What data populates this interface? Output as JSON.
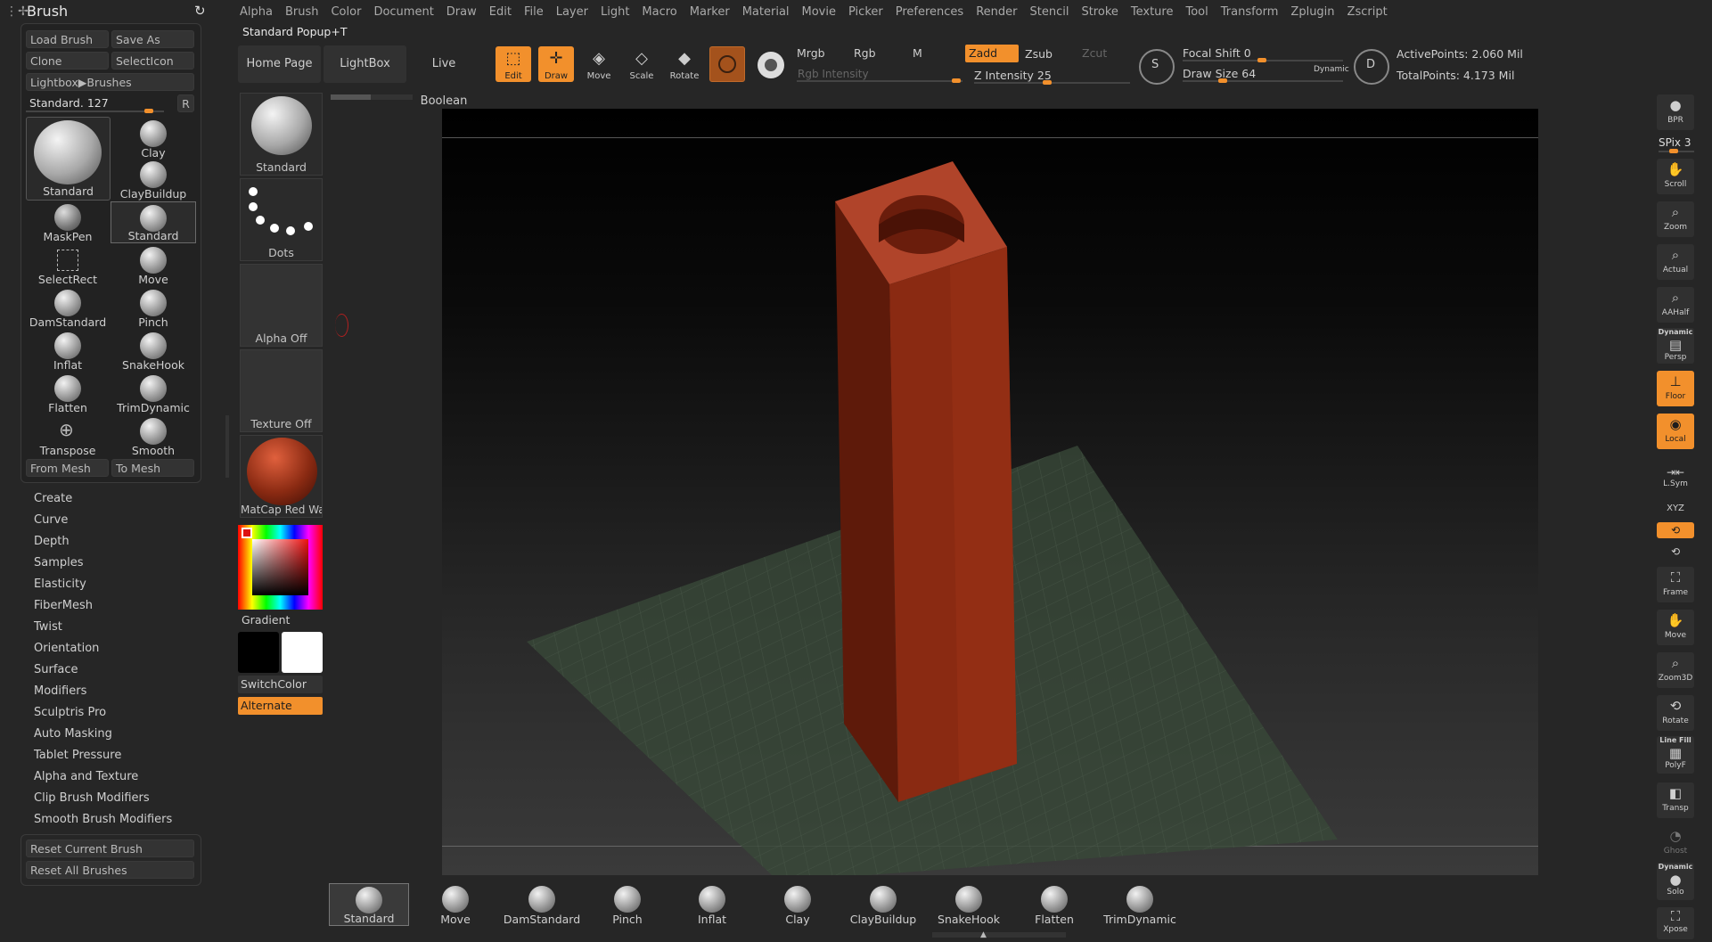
{
  "menu": [
    "Alpha",
    "Brush",
    "Color",
    "Document",
    "Draw",
    "Edit",
    "File",
    "Layer",
    "Light",
    "Macro",
    "Marker",
    "Material",
    "Movie",
    "Picker",
    "Preferences",
    "Render",
    "Stencil",
    "Stroke",
    "Texture",
    "Tool",
    "Transform",
    "Zplugin",
    "Zscript"
  ],
  "brush_panel": {
    "title": "Brush",
    "load": "Load Brush",
    "save_as": "Save As",
    "clone": "Clone",
    "select_icon": "SelectIcon",
    "lightbox_brushes": "Lightbox▶Brushes",
    "slider_label": "Standard. 127",
    "r": "R",
    "current": "Standard",
    "brushes": [
      "Clay",
      "ClayBuildup",
      "MaskPen",
      "Standard",
      "SelectRect",
      "Move",
      "DamStandard",
      "Pinch",
      "Inflat",
      "SnakeHook",
      "Flatten",
      "TrimDynamic",
      "Transpose",
      "Smooth"
    ],
    "from_mesh": "From Mesh",
    "to_mesh": "To Mesh",
    "subpalettes": [
      "Create",
      "Curve",
      "Depth",
      "Samples",
      "Elasticity",
      "FiberMesh",
      "Twist",
      "Orientation",
      "Surface",
      "Modifiers",
      "Sculptris Pro",
      "Auto Masking",
      "Tablet Pressure",
      "Alpha and Texture",
      "Clip Brush Modifiers",
      "Smooth Brush Modifiers"
    ],
    "reset_current": "Reset Current Brush",
    "reset_all": "Reset All Brushes"
  },
  "popup_title": "Standard Popup+T",
  "tool_column": {
    "brush": "Standard",
    "stroke": "Dots",
    "alpha": "Alpha Off",
    "texture": "Texture Off",
    "material": "MatCap Red Wax",
    "gradient": "Gradient",
    "switch_color": "SwitchColor",
    "alternate": "Alternate"
  },
  "top": {
    "home": "Home Page",
    "lightbox": "LightBox",
    "live_boolean": "Live Boolean",
    "edit": "Edit",
    "draw": "Draw",
    "move": "Move",
    "scale": "Scale",
    "rotate": "Rotate",
    "mrgb": "Mrgb",
    "rgb": "Rgb",
    "m": "M",
    "zadd": "Zadd",
    "zsub": "Zsub",
    "zcut": "Zcut",
    "rgb_intensity": "Rgb Intensity",
    "z_intensity": "Z Intensity 25",
    "focal_shift": "Focal Shift 0",
    "draw_size": "Draw Size 64",
    "dynamic": "Dynamic",
    "active_points": "ActivePoints: 2.060 Mil",
    "total_points": "TotalPoints: 4.173 Mil",
    "z_intensity_value": 25,
    "draw_size_value": 64,
    "brush_slider_value": 127
  },
  "right_shelf": {
    "bpr": "BPR",
    "spix": "SPix 3",
    "scroll": "Scroll",
    "zoom": "Zoom",
    "actual": "Actual",
    "aahalf": "AAHalf",
    "dynamic": "Dynamic",
    "persp": "Persp",
    "floor": "Floor",
    "local": "Local",
    "lsym": "L.Sym",
    "xyz": "XYZ",
    "frame": "Frame",
    "move": "Move",
    "zoom3d": "Zoom3D",
    "rotate": "Rotate",
    "linefill": "Line Fill",
    "polyf": "PolyF",
    "transp": "Transp",
    "ghost": "Ghost",
    "dynamic2": "Dynamic",
    "solo": "Solo",
    "xpose": "Xpose"
  },
  "bottom_shelf": [
    "Standard",
    "Move",
    "DamStandard",
    "Pinch",
    "Inflat",
    "Clay",
    "ClayBuildup",
    "SnakeHook",
    "Flatten",
    "TrimDynamic"
  ],
  "colors": {
    "accent": "#f2902c",
    "object": "#8a2a12",
    "floor_grid": "#3b4a3b"
  }
}
